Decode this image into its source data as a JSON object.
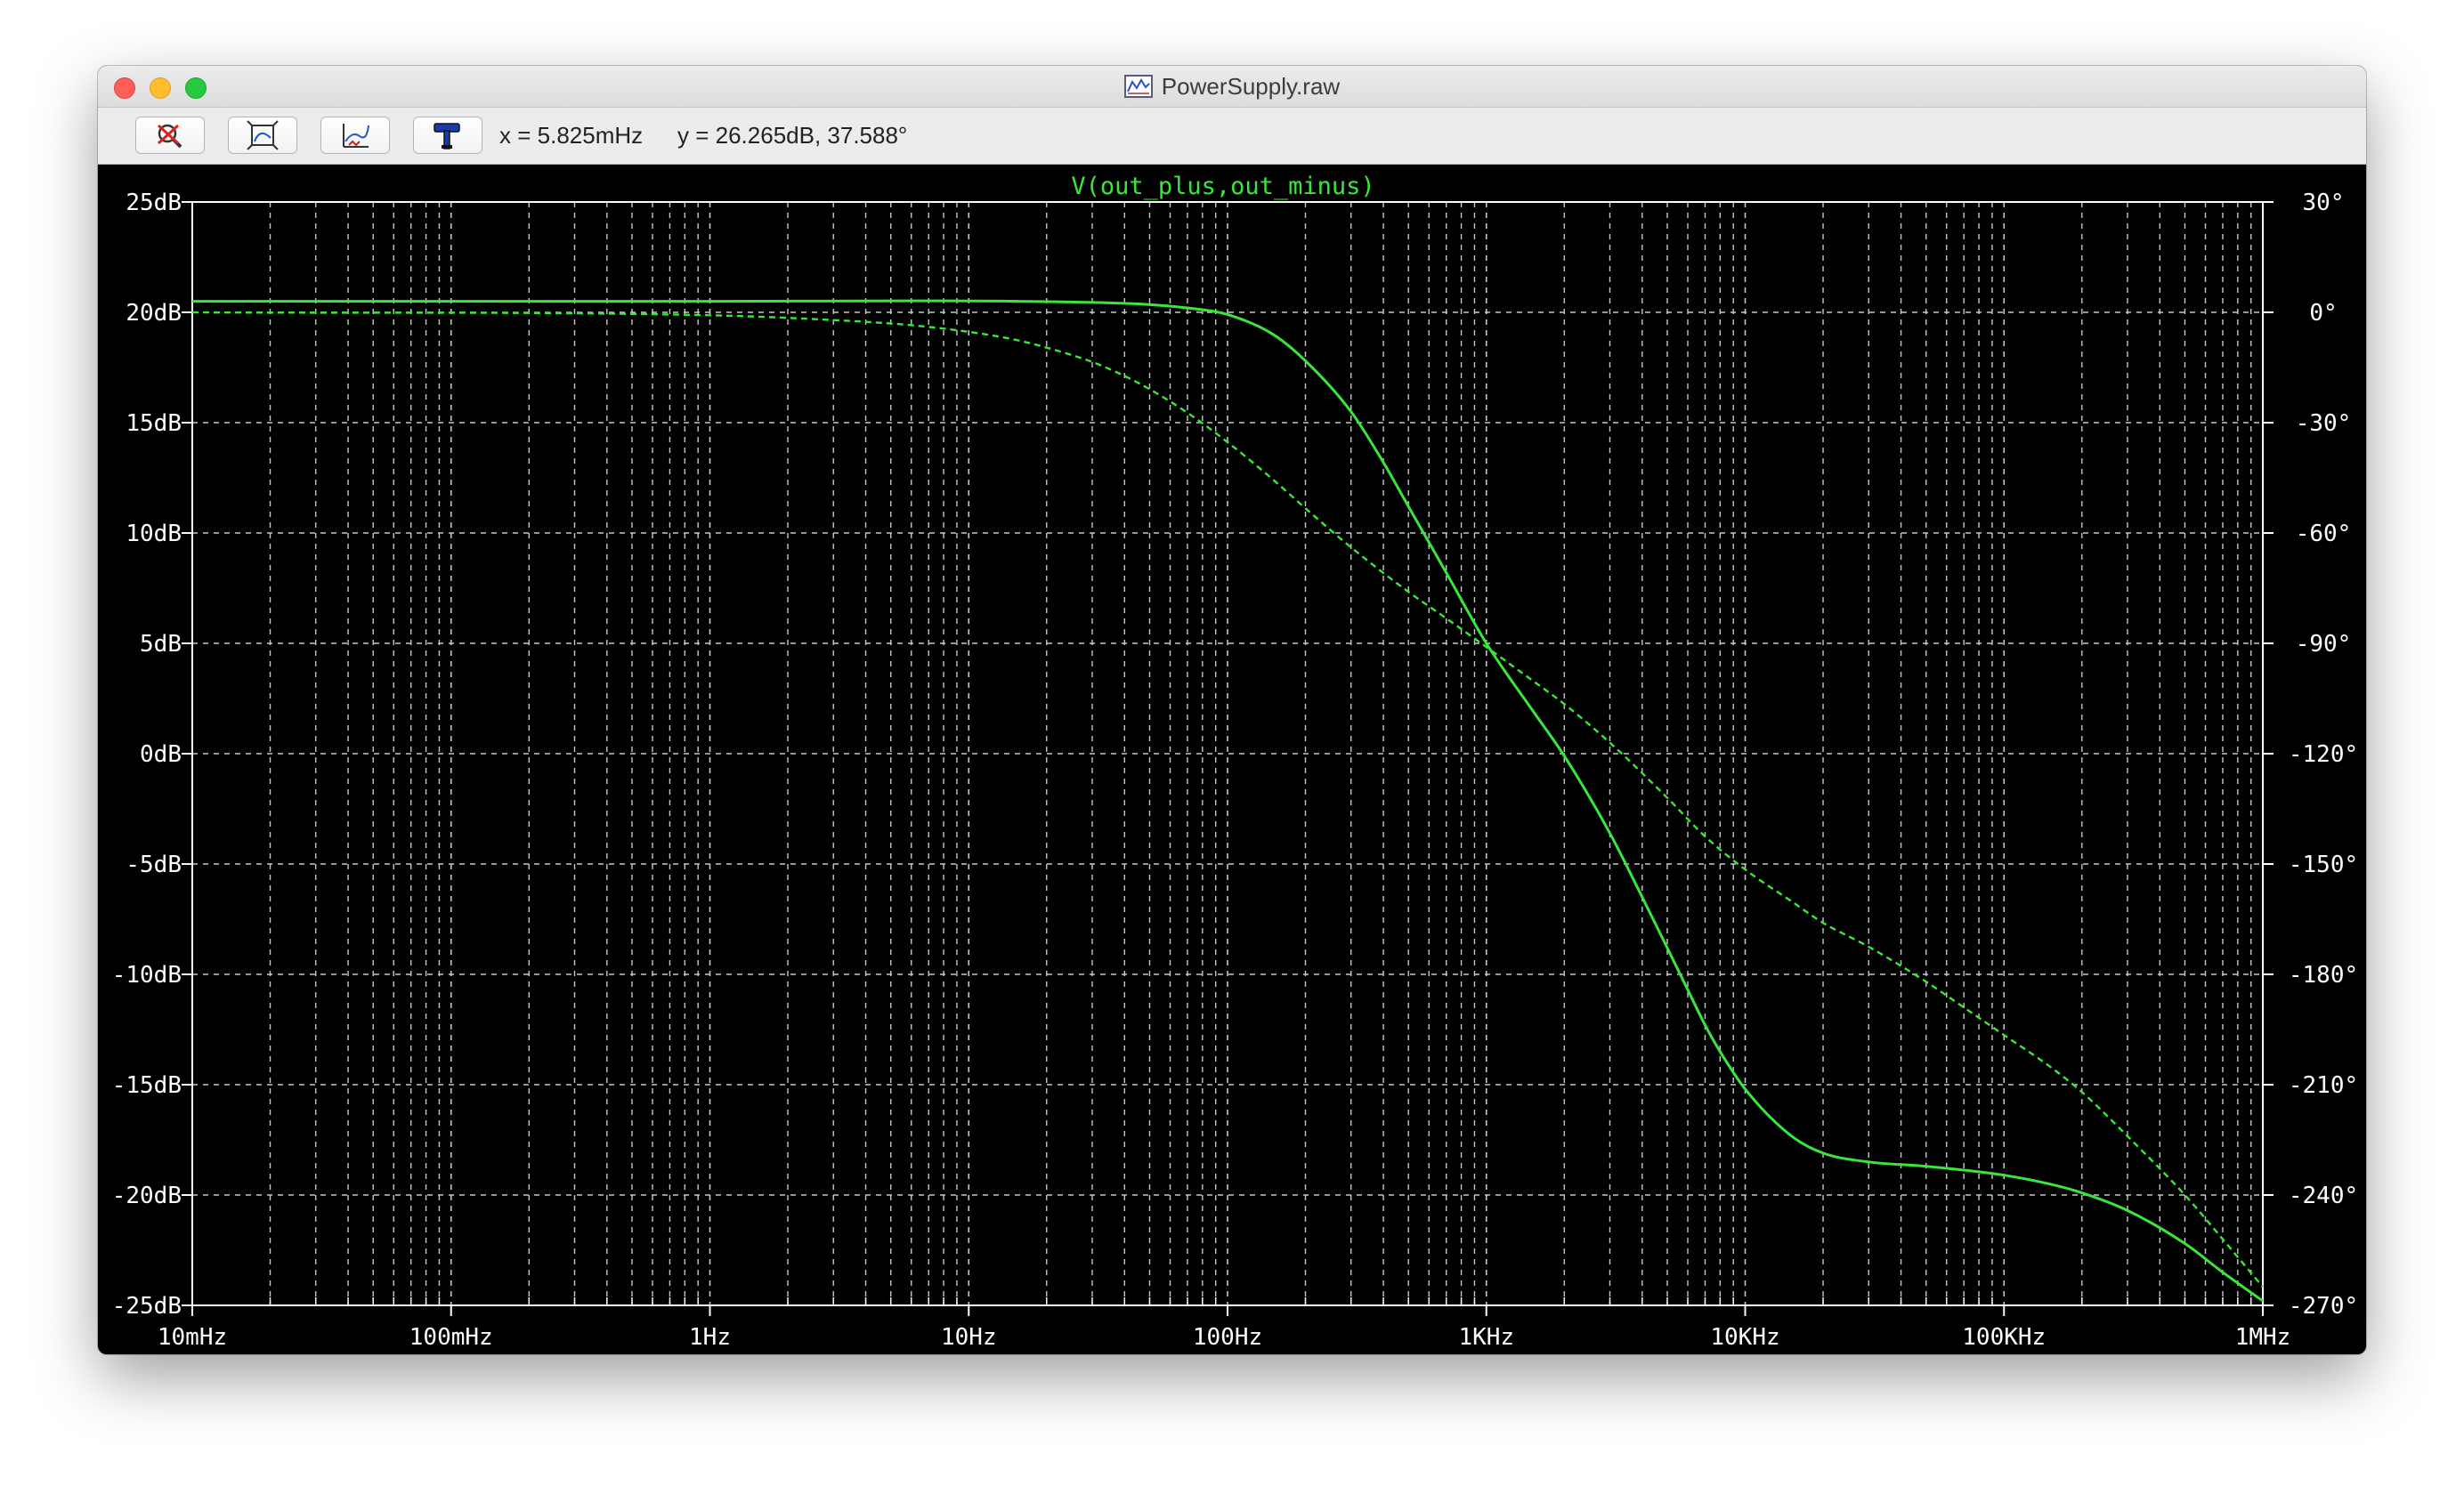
{
  "window": {
    "title": "PowerSupply.raw",
    "icon": "waveform-file-icon"
  },
  "toolbar": {
    "buttons": [
      {
        "name": "zoom-cancel-button",
        "icon": "zoom-cancel-icon"
      },
      {
        "name": "zoom-full-extents-button",
        "icon": "zoom-extents-icon"
      },
      {
        "name": "autorange-y-button",
        "icon": "autorange-icon"
      },
      {
        "name": "probe-button",
        "icon": "probe-hammer-icon"
      }
    ],
    "cursor_x": "x = 5.825mHz",
    "cursor_y": "y = 26.265dB, 37.588°"
  },
  "colors": {
    "trace": "#39e639",
    "background": "#000000",
    "grid": "#c8c8c8",
    "tick_text": "#ffffff"
  },
  "chart_data": {
    "type": "line",
    "title": "V(out_plus,out_minus)",
    "x_scale": "log",
    "xlim": [
      0.01,
      1000000
    ],
    "ylim": [
      -25,
      25
    ],
    "y2lim": [
      -270,
      30
    ],
    "grid": true,
    "x_ticks": [
      {
        "value": 0.01,
        "label": "10mHz"
      },
      {
        "value": 0.1,
        "label": "100mHz"
      },
      {
        "value": 1,
        "label": "1Hz"
      },
      {
        "value": 10,
        "label": "10Hz"
      },
      {
        "value": 100,
        "label": "100Hz"
      },
      {
        "value": 1000,
        "label": "1KHz"
      },
      {
        "value": 10000,
        "label": "10KHz"
      },
      {
        "value": 100000,
        "label": "100KHz"
      },
      {
        "value": 1000000,
        "label": "1MHz"
      }
    ],
    "y_ticks": [
      {
        "value": 25,
        "label": "25dB"
      },
      {
        "value": 20,
        "label": "20dB"
      },
      {
        "value": 15,
        "label": "15dB"
      },
      {
        "value": 10,
        "label": "10dB"
      },
      {
        "value": 5,
        "label": "5dB"
      },
      {
        "value": 0,
        "label": "0dB"
      },
      {
        "value": -5,
        "label": "-5dB"
      },
      {
        "value": -10,
        "label": "-10dB"
      },
      {
        "value": -15,
        "label": "-15dB"
      },
      {
        "value": -20,
        "label": "-20dB"
      },
      {
        "value": -25,
        "label": "-25dB"
      }
    ],
    "y2_ticks": [
      {
        "value": 30,
        "label": "30°"
      },
      {
        "value": 0,
        "label": "0°"
      },
      {
        "value": -30,
        "label": "-30°"
      },
      {
        "value": -60,
        "label": "-60°"
      },
      {
        "value": -90,
        "label": "-90°"
      },
      {
        "value": -120,
        "label": "-120°"
      },
      {
        "value": -150,
        "label": "-150°"
      },
      {
        "value": -180,
        "label": "-180°"
      },
      {
        "value": -210,
        "label": "-210°"
      },
      {
        "value": -240,
        "label": "-240°"
      },
      {
        "value": -270,
        "label": "-270°"
      }
    ],
    "series": [
      {
        "style": "solid",
        "axis": "y",
        "x": [
          0.01,
          1,
          30,
          50,
          70,
          100,
          150,
          200,
          300,
          400,
          500,
          700,
          1000,
          1500,
          2000,
          3000,
          4000,
          5000,
          6000,
          7000,
          8000,
          10000,
          15000,
          20000,
          30000,
          50000,
          100000,
          150000,
          200000,
          300000,
          500000,
          700000,
          1000000
        ],
        "values": [
          20.5,
          20.5,
          20.45,
          20.35,
          20.2,
          19.9,
          19.0,
          17.8,
          15.5,
          13.2,
          11.2,
          8.2,
          5.0,
          2.0,
          -0.1,
          -3.6,
          -6.5,
          -8.8,
          -10.7,
          -12.3,
          -13.5,
          -15.2,
          -17.3,
          -18.1,
          -18.5,
          -18.7,
          -19.1,
          -19.5,
          -19.9,
          -20.7,
          -22.2,
          -23.5,
          -24.8
        ]
      },
      {
        "style": "dashed",
        "axis": "y2",
        "x": [
          0.01,
          1,
          3,
          6,
          10,
          15,
          20,
          30,
          40,
          50,
          70,
          100,
          150,
          200,
          300,
          500,
          700,
          1000,
          1500,
          2000,
          3000,
          5000,
          7000,
          10000,
          15000,
          20000,
          30000,
          50000,
          70000,
          100000,
          150000,
          200000,
          300000,
          500000,
          700000,
          1000000
        ],
        "values": [
          0,
          -0.8,
          -2.1,
          -3.5,
          -5.3,
          -7.4,
          -9.6,
          -13.5,
          -17.3,
          -20.9,
          -27.3,
          -35.3,
          -45.5,
          -53.3,
          -63.9,
          -76.0,
          -83.2,
          -91.0,
          -100.0,
          -106.5,
          -117.0,
          -132.0,
          -142.5,
          -151.5,
          -160.0,
          -166.0,
          -172.5,
          -182.0,
          -189.0,
          -196.5,
          -205.0,
          -212.0,
          -224.0,
          -240.0,
          -252.0,
          -265.0
        ]
      }
    ]
  }
}
